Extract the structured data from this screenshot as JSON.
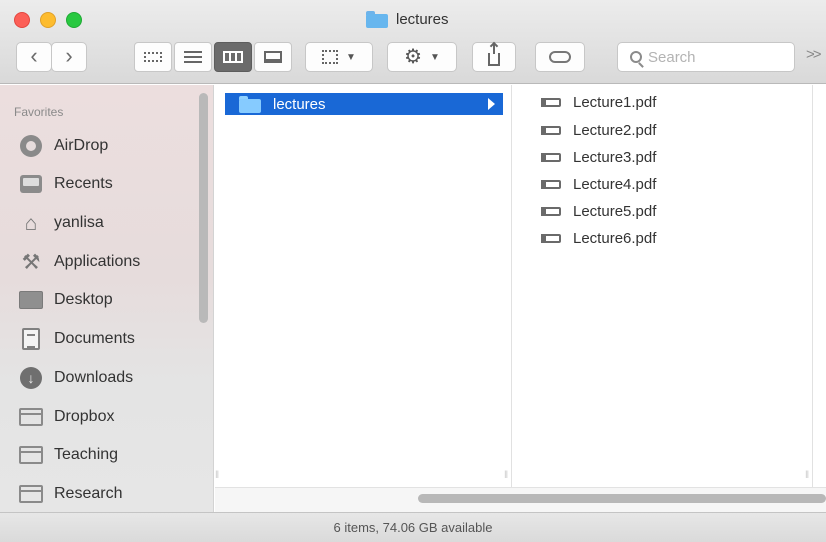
{
  "window": {
    "title": "lectures",
    "title_icon": "folder-icon",
    "controls": [
      "close",
      "minimize",
      "maximize"
    ]
  },
  "toolbar": {
    "back_icon": "chevron-left-icon",
    "forward_icon": "chevron-right-icon",
    "view_modes": [
      {
        "icon": "icon-view-icon",
        "active": false
      },
      {
        "icon": "list-view-icon",
        "active": false
      },
      {
        "icon": "column-view-icon",
        "active": true
      },
      {
        "icon": "gallery-view-icon",
        "active": false
      }
    ],
    "arrange_icon": "arrange-icon",
    "action_icon": "gear-icon",
    "share_icon": "share-icon",
    "tags_icon": "tag-icon",
    "search": {
      "placeholder": "Search",
      "value": ""
    },
    "overflow_label": ">>"
  },
  "sidebar": {
    "section_title": "Favorites",
    "items": [
      {
        "label": "AirDrop",
        "icon": "airdrop-icon"
      },
      {
        "label": "Recents",
        "icon": "recents-icon"
      },
      {
        "label": "yanlisa",
        "icon": "home-icon"
      },
      {
        "label": "Applications",
        "icon": "applications-icon"
      },
      {
        "label": "Desktop",
        "icon": "desktop-icon"
      },
      {
        "label": "Documents",
        "icon": "documents-icon"
      },
      {
        "label": "Downloads",
        "icon": "downloads-icon"
      },
      {
        "label": "Dropbox",
        "icon": "folder-icon"
      },
      {
        "label": "Teaching",
        "icon": "folder-icon"
      },
      {
        "label": "Research",
        "icon": "folder-icon"
      }
    ]
  },
  "columns": {
    "first": {
      "selected_item": "lectures"
    },
    "second": {
      "files": [
        "Lecture1.pdf",
        "Lecture2.pdf",
        "Lecture3.pdf",
        "Lecture4.pdf",
        "Lecture5.pdf",
        "Lecture6.pdf"
      ]
    }
  },
  "status": {
    "text": "6 items, 74.06 GB available"
  },
  "colors": {
    "selection": "#1968d6",
    "folder": "#67b6ee",
    "close": "#fc5f57",
    "minimize": "#fdbc2e",
    "maximize": "#28c840"
  }
}
